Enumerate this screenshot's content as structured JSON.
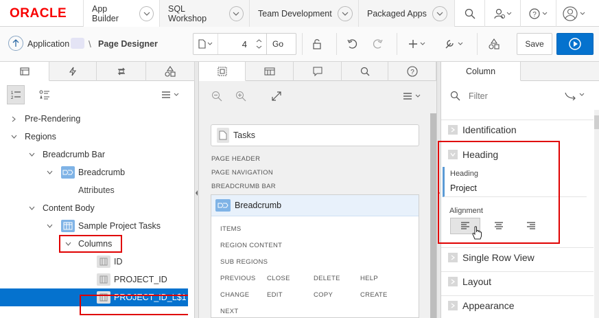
{
  "nav": {
    "logo": "ORACLE",
    "tabs": [
      {
        "label": "App Builder"
      },
      {
        "label": "SQL Workshop"
      },
      {
        "label": "Team Development"
      },
      {
        "label": "Packaged Apps"
      }
    ]
  },
  "toolbar": {
    "app_label": "Application",
    "separator": "\\",
    "page_designer": "Page Designer",
    "page_number": "4",
    "go_label": "Go",
    "save_label": "Save"
  },
  "left_panel": {
    "tree": [
      {
        "label": "Pre-Rendering"
      },
      {
        "label": "Regions"
      },
      {
        "label": "Breadcrumb Bar"
      },
      {
        "label": "Breadcrumb"
      },
      {
        "label": "Attributes"
      },
      {
        "label": "Content Body"
      },
      {
        "label": "Sample Project Tasks"
      },
      {
        "label": "Columns"
      },
      {
        "label": "ID"
      },
      {
        "label": "PROJECT_ID"
      },
      {
        "label": "PROJECT_ID_L$1"
      }
    ]
  },
  "middle_panel": {
    "page_title": "Tasks",
    "sections": [
      "PAGE HEADER",
      "PAGE NAVIGATION",
      "BREADCRUMB BAR"
    ],
    "region_title": "Breadcrumb",
    "region_labels": [
      "ITEMS",
      "REGION CONTENT",
      "SUB REGIONS"
    ],
    "button_positions": [
      "PREVIOUS",
      "CLOSE",
      "DELETE",
      "HELP",
      "CHANGE",
      "EDIT",
      "COPY",
      "CREATE",
      "NEXT"
    ]
  },
  "right_panel": {
    "tab_label": "Column",
    "filter_placeholder": "Filter",
    "groups": {
      "identification": "Identification",
      "heading": "Heading",
      "single_row_view": "Single Row View",
      "layout": "Layout",
      "appearance": "Appearance"
    },
    "heading_prop_label": "Heading",
    "heading_prop_value": "Project",
    "alignment_label": "Alignment",
    "alignment_selected": "left"
  },
  "colors": {
    "oracle_red": "#f80000",
    "accent_blue": "#0572ce",
    "highlight_red": "#e00000"
  }
}
